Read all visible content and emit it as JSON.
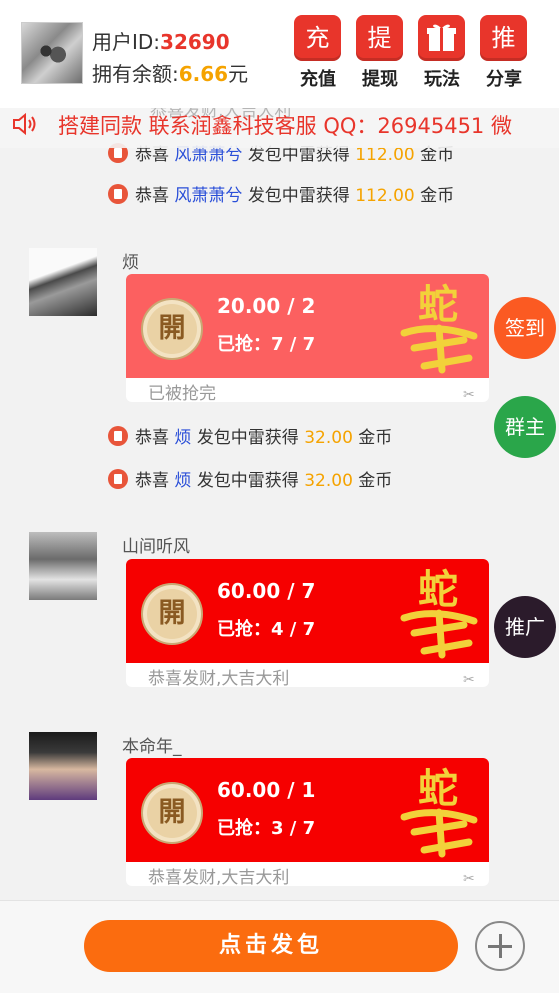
{
  "header": {
    "uid_label": "用户ID:",
    "uid_value": "32690",
    "balance_label": "拥有余额:",
    "balance_value": "6.66",
    "balance_unit": "元",
    "buttons": [
      {
        "glyph": "充",
        "label": "充值",
        "icon": "recharge-icon"
      },
      {
        "glyph": "提",
        "label": "提现",
        "icon": "withdraw-icon"
      },
      {
        "glyph": "",
        "label": "玩法",
        "icon": "gift-icon"
      },
      {
        "glyph": "推",
        "label": "分享",
        "icon": "share-icon"
      }
    ]
  },
  "marquee": {
    "ghost_text": "恭喜发财,大吉大利",
    "text": "搭建同款 联系润鑫科技客服 QQ：26945451 微"
  },
  "notices": [
    {
      "prefix": "恭喜",
      "name": "风萧萧兮",
      "middle": "发包中雷获得",
      "amount": "112.00",
      "unit": "金币"
    },
    {
      "prefix": "恭喜",
      "name": "风萧萧兮",
      "middle": "发包中雷获得",
      "amount": "112.00",
      "unit": "金币"
    },
    {
      "prefix": "恭喜",
      "name": "烦",
      "middle": "发包中雷获得",
      "amount": "32.00",
      "unit": "金币"
    },
    {
      "prefix": "恭喜",
      "name": "烦",
      "middle": "发包中雷获得",
      "amount": "32.00",
      "unit": "金币"
    }
  ],
  "messages": [
    {
      "sender": "烦",
      "open_glyph": "開",
      "amount": "20.00 / 2",
      "grabbed": "已抢：7 / 7",
      "blessing": "已被抢完",
      "art": "蛇年大吉"
    },
    {
      "sender": "山间听风",
      "open_glyph": "開",
      "amount": "60.00 / 7",
      "grabbed": "已抢：4 / 7",
      "blessing": "恭喜发财,大吉大利",
      "art": "蛇年大吉"
    },
    {
      "sender": "本命年_",
      "open_glyph": "開",
      "amount": "60.00 / 1",
      "grabbed": "已抢：3 / 7",
      "blessing": "恭喜发财,大吉大利",
      "art": "蛇年大吉"
    }
  ],
  "float_buttons": [
    {
      "label": "签到",
      "color": "#fb5a22"
    },
    {
      "label": "群主",
      "color": "#2aa64a"
    },
    {
      "label": "推广",
      "color": "#2b1b2b"
    }
  ],
  "bottom": {
    "send_label": "点击发包",
    "plus_icon": "plus-icon"
  },
  "colors": {
    "accent_red": "#e8352b",
    "packet_red": "#f60000",
    "packet_done": "#fc6060",
    "gold": "#f5a300",
    "send_orange": "#fb6c0f"
  }
}
